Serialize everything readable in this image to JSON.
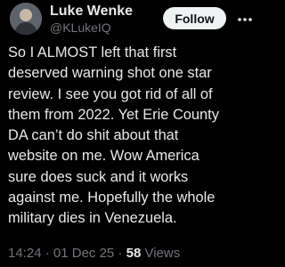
{
  "author": {
    "display_name": "Luke Wenke",
    "handle": "@KLukeIQ"
  },
  "follow_button_label": "Follow",
  "more_icon": "ellipsis-icon",
  "tweet_lines": [
    "So I ALMOST left that first",
    "deserved warning shot one star",
    "review.  I see you got rid of all of",
    "them from 2022.  Yet Erie County",
    "DA can’t do shit about that",
    "website on me.  Wow America",
    "sure does suck and it works",
    "against me.  Hopefully the whole",
    "military dies in Venezuela."
  ],
  "meta": {
    "time": "14:24",
    "separator": "·",
    "date": "01 Dec 25",
    "views_count": "58",
    "views_label": "Views"
  },
  "colors": {
    "background": "#000000",
    "text_primary": "#e7e9ea",
    "text_secondary": "#71767b",
    "button_bg": "#eff3f4",
    "button_text": "#0f1419"
  }
}
